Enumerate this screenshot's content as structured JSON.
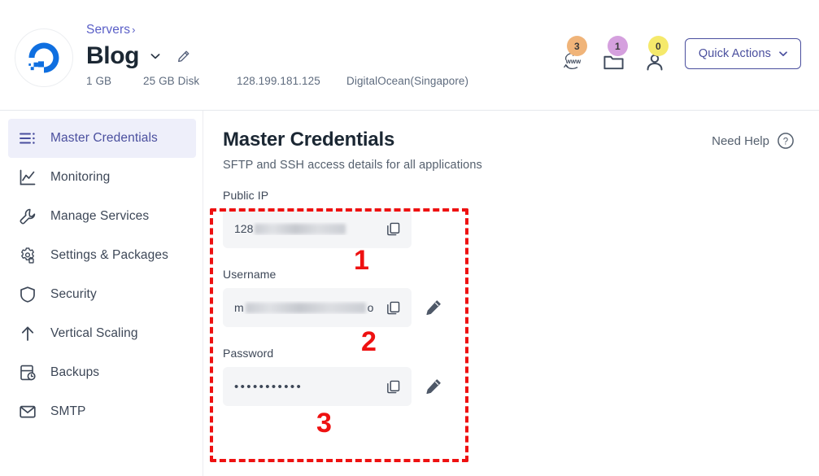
{
  "header": {
    "logo_icon": "digitalocean-logo",
    "breadcrumb": "Servers",
    "breadcrumb_chevron": "›",
    "server_name": "Blog",
    "dropdown_icon": "chevron-down-icon",
    "edit_icon": "pencil-icon",
    "specs": {
      "ram": "1 GB",
      "disk": "25 GB Disk",
      "ip": "128.199.181.125",
      "provider": "DigitalOcean(Singapore)"
    },
    "badges": [
      {
        "icon": "www-globe-icon",
        "count": "3",
        "color": "#f0b479"
      },
      {
        "icon": "folder-icon",
        "count": "1",
        "color": "#d5a0de"
      },
      {
        "icon": "user-icon",
        "count": "0",
        "color": "#f5e96b"
      }
    ],
    "quick_actions": {
      "label": "Quick Actions",
      "chevron_icon": "chevron-down-icon"
    }
  },
  "sidebar": {
    "items": [
      {
        "label": "Master Credentials",
        "icon": "credentials-list-icon",
        "active": true
      },
      {
        "label": "Monitoring",
        "icon": "chart-line-icon",
        "active": false
      },
      {
        "label": "Manage Services",
        "icon": "wrench-icon",
        "active": false
      },
      {
        "label": "Settings & Packages",
        "icon": "gear-icon",
        "active": false
      },
      {
        "label": "Security",
        "icon": "shield-icon",
        "active": false
      },
      {
        "label": "Vertical Scaling",
        "icon": "arrow-up-icon",
        "active": false
      },
      {
        "label": "Backups",
        "icon": "backup-icon",
        "active": false
      },
      {
        "label": "SMTP",
        "icon": "envelope-icon",
        "active": false
      }
    ]
  },
  "main": {
    "title": "Master Credentials",
    "subtitle": "SFTP and SSH access details for all applications",
    "need_help": {
      "label": "Need Help",
      "icon": "question-circle-icon"
    },
    "fields": [
      {
        "label": "Public IP",
        "value_prefix": "128",
        "value_redacted": true,
        "value_suffix": "",
        "masked": false,
        "copy_icon": "copy-icon",
        "has_edit": false,
        "edit_icon": "pencil-icon"
      },
      {
        "label": "Username",
        "value_prefix": "m",
        "value_redacted": true,
        "value_suffix": "o",
        "masked": false,
        "copy_icon": "copy-icon",
        "has_edit": true,
        "edit_icon": "pencil-icon"
      },
      {
        "label": "Password",
        "value_prefix": "",
        "value_redacted": false,
        "value_suffix": "",
        "masked": true,
        "masked_value": "•••••••••••",
        "copy_icon": "copy-icon",
        "has_edit": true,
        "edit_icon": "pencil-icon"
      }
    ]
  },
  "annotations": {
    "box_color": "#ee1111",
    "markers": [
      {
        "number": "1",
        "target": "public-ip-field"
      },
      {
        "number": "2",
        "target": "username-field"
      },
      {
        "number": "3",
        "target": "password-field"
      }
    ]
  }
}
